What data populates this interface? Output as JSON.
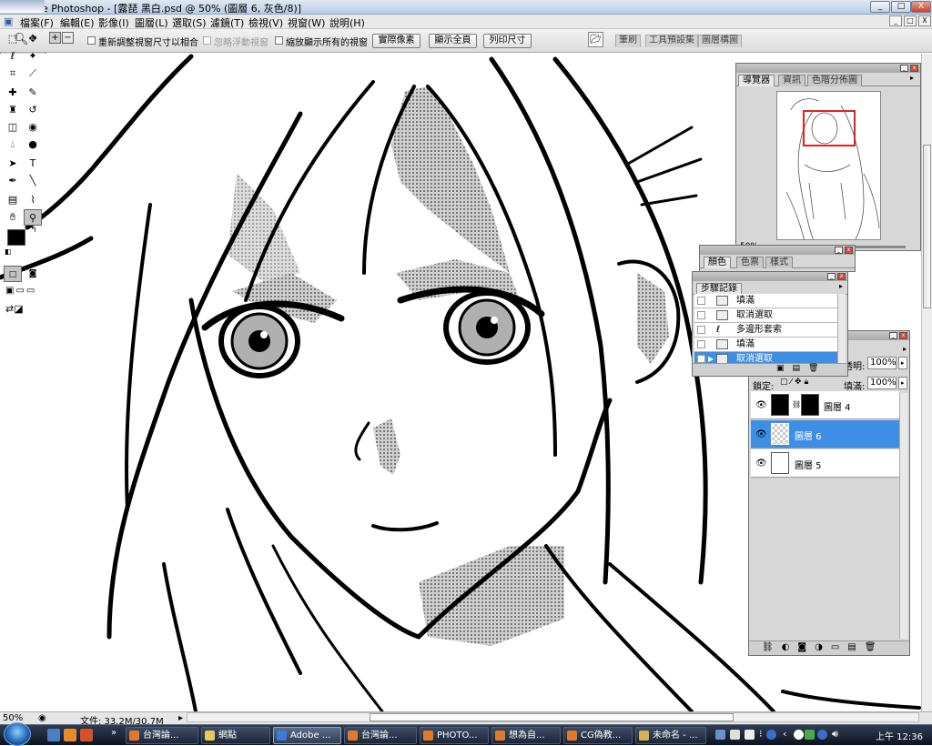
{
  "window": {
    "title": "Adobe Photoshop - [露琵 黑白.psd @ 50% (圖層 6, 灰色/8)]",
    "controls": [
      "_",
      "□",
      "X"
    ]
  },
  "menu": {
    "items": [
      "檔案(F)",
      "編輯(E)",
      "影像(I)",
      "圖層(L)",
      "選取(S)",
      "濾鏡(T)",
      "檢視(V)",
      "視窗(W)",
      "說明(H)"
    ],
    "doc_controls": [
      "_",
      "□",
      "X"
    ]
  },
  "options": {
    "checkbox1": "重新調整視窗尺寸以相合",
    "checkbox2": "忽略浮動視窗",
    "checkbox3": "縮放顯示所有的視窗",
    "btn_actual": "實際像素",
    "btn_fit": "顯示全頁",
    "btn_print": "列印尺寸",
    "wells": [
      "筆刷",
      "工具預設集",
      "圖層構圖"
    ]
  },
  "status": {
    "zoom": "50%",
    "doc": "文件: 33.2M/30.7M"
  },
  "navigator": {
    "tabs": [
      "導覽器",
      "資訊",
      "色階分佈圖"
    ],
    "zoom": "50%"
  },
  "color_panel": {
    "tabs": [
      "顏色",
      "色票",
      "樣式"
    ]
  },
  "history": {
    "tabs": [
      "步驟記錄"
    ],
    "items": [
      "填滿",
      "取消選取",
      "多邊形套索",
      "填滿",
      "取消選取"
    ],
    "selected_index": 4
  },
  "layers": {
    "opacity_label": "透明:",
    "opacity_value": "100%",
    "lock_label": "鎖定:",
    "fill_label": "填滿:",
    "fill_value": "100%",
    "rows": [
      {
        "name": "圖層 4"
      },
      {
        "name": "圖層 6"
      },
      {
        "name": "圖層 5"
      }
    ],
    "selected_index": 1
  },
  "taskbar": {
    "tasks": [
      "台灣論...",
      "網點",
      "Adobe ...",
      "台灣論...",
      "PHOTO...",
      "想為自...",
      "CG偽教...",
      "未命名 - ..."
    ],
    "active_index": 2,
    "clock": "上午 12:36"
  },
  "colors": {
    "selection": "#3d8fe6",
    "foreground": "#000000",
    "background": "#ffffff"
  }
}
